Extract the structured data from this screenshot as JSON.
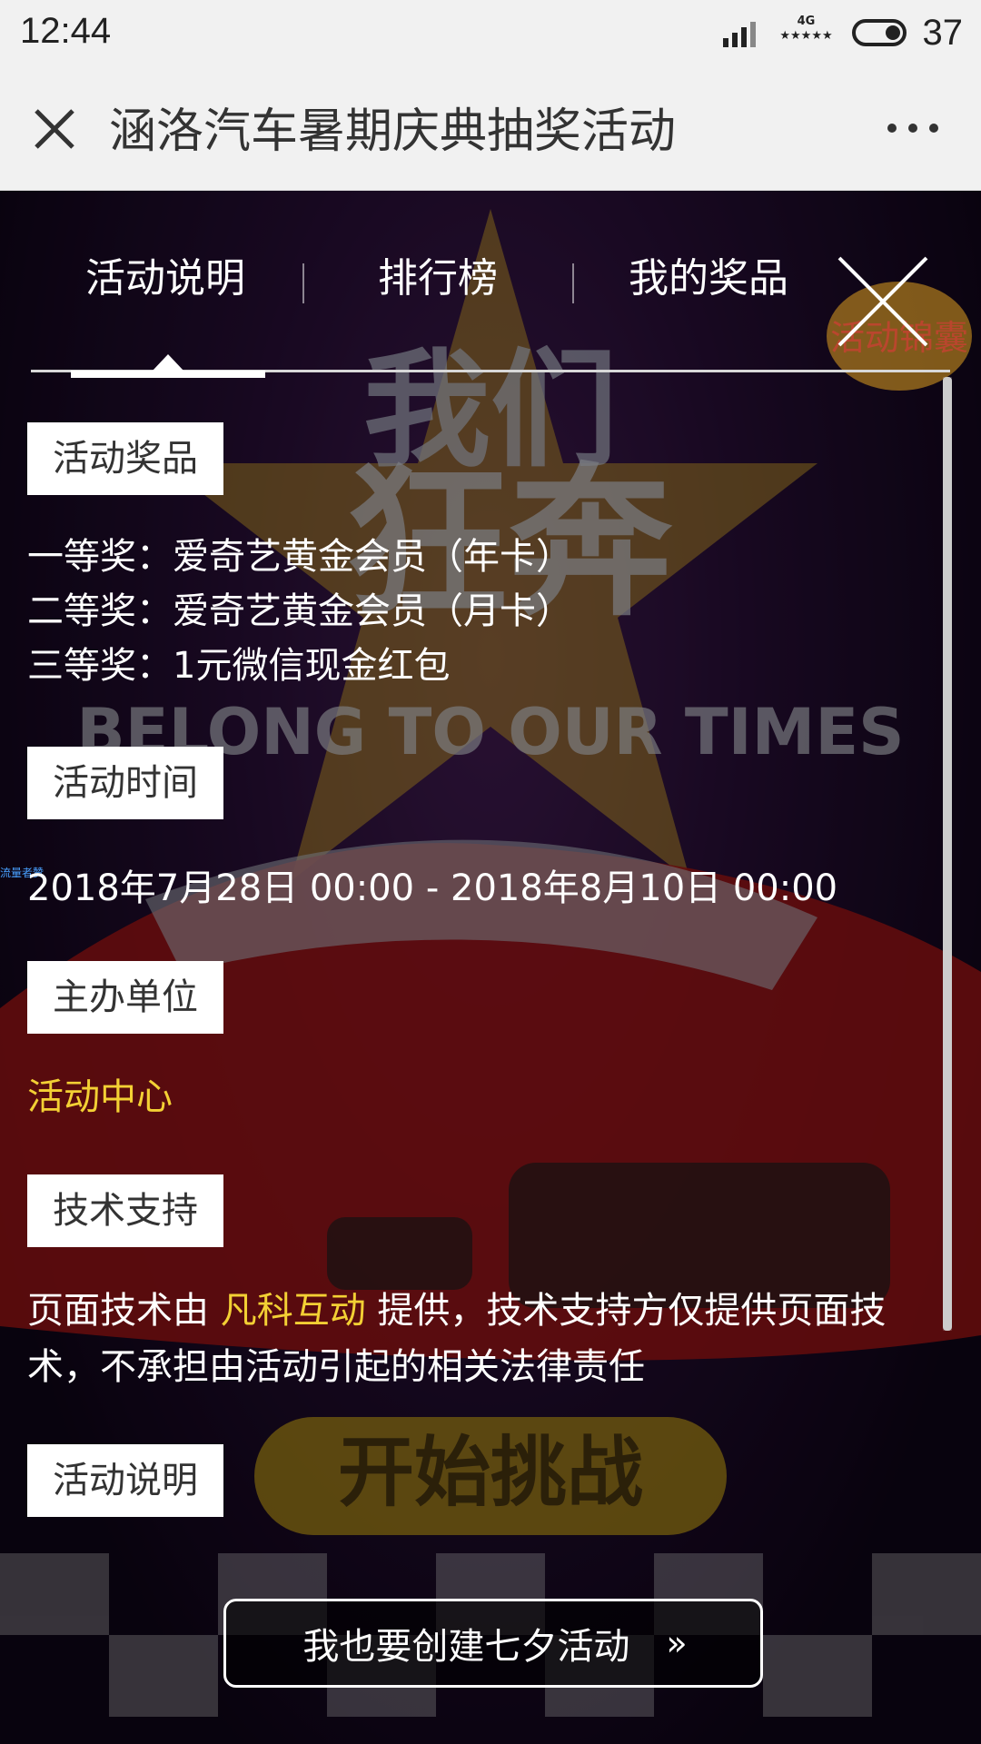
{
  "status_bar": {
    "time": "12:44",
    "network": "4G",
    "network_sub": "★★★★★",
    "battery": "37"
  },
  "title_bar": {
    "title": "涵洛汽车暑期庆典抽奖活动"
  },
  "tabs": [
    {
      "label": "活动说明",
      "active": true
    },
    {
      "label": "排行榜",
      "active": false
    },
    {
      "label": "我的奖品",
      "active": false
    }
  ],
  "bag_badge": "活动锦囊",
  "background": {
    "headline": "我们",
    "headline2": "狂奔",
    "slogan": "BELONG TO OUR TIMES",
    "cta": "开始挑战"
  },
  "sections": {
    "prizes": {
      "label": "活动奖品",
      "lines": [
        "一等奖：爱奇艺黄金会员（年卡）",
        "二等奖：爱奇艺黄金会员（月卡）",
        "三等奖：1元微信现金红包"
      ]
    },
    "time": {
      "label": "活动时间",
      "value": "2018年7月28日 00:00 - 2018年8月10日 00:00"
    },
    "organizer": {
      "label": "主办单位",
      "value": "活动中心"
    },
    "support": {
      "label": "技术支持",
      "prefix": "页面技术由 ",
      "company": "凡科互动",
      "suffix": " 提供，技术支持方仅提供页面技",
      "line2": "术，不承担由活动引起的相关法律责任"
    },
    "description": {
      "label": "活动说明"
    }
  },
  "tiny_tag": "流量者赞",
  "create_button": {
    "label": "我也要创建七夕活动",
    "chevron": "»"
  },
  "colors": {
    "accent_yellow": "#f3d034",
    "bg_purple": "#2a0f3a"
  }
}
